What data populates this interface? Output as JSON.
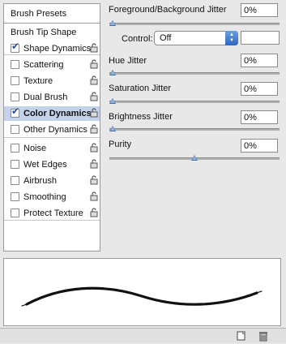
{
  "left_panel": {
    "presets_label": "Brush Presets",
    "tip_label": "Brush Tip Shape",
    "options": [
      {
        "label": "Shape Dynamics",
        "checked": true,
        "selected": false
      },
      {
        "label": "Scattering",
        "checked": false,
        "selected": false
      },
      {
        "label": "Texture",
        "checked": false,
        "selected": false
      },
      {
        "label": "Dual Brush",
        "checked": false,
        "selected": false
      },
      {
        "label": "Color Dynamics",
        "checked": true,
        "selected": true
      },
      {
        "label": "Other Dynamics",
        "checked": false,
        "selected": false
      },
      {
        "label": "Noise",
        "checked": false,
        "selected": false
      },
      {
        "label": "Wet Edges",
        "checked": false,
        "selected": false
      },
      {
        "label": "Airbrush",
        "checked": false,
        "selected": false
      },
      {
        "label": "Smoothing",
        "checked": false,
        "selected": false
      },
      {
        "label": "Protect Texture",
        "checked": false,
        "selected": false
      }
    ],
    "lock_icon": "lock-icon"
  },
  "controls": {
    "fg_bg_jitter": {
      "label": "Foreground/Background Jitter",
      "value": "0%",
      "level": 0
    },
    "control": {
      "label": "Control:",
      "selected": "Off"
    },
    "hue_jitter": {
      "label": "Hue Jitter",
      "value": "0%",
      "level": 0
    },
    "saturation_jitter": {
      "label": "Saturation Jitter",
      "value": "0%",
      "level": 0
    },
    "brightness_jitter": {
      "label": "Brightness Jitter",
      "value": "0%",
      "level": 0
    },
    "purity": {
      "label": "Purity",
      "value": "0%",
      "level": 0.5
    }
  },
  "bottom_bar": {
    "new_icon": "new-preset-icon",
    "delete_icon": "trash-icon"
  },
  "colors": {
    "selection": "#c4d3ea",
    "slider_knob": "#3b6ea8",
    "panel_bg": "#e8e8e8"
  }
}
